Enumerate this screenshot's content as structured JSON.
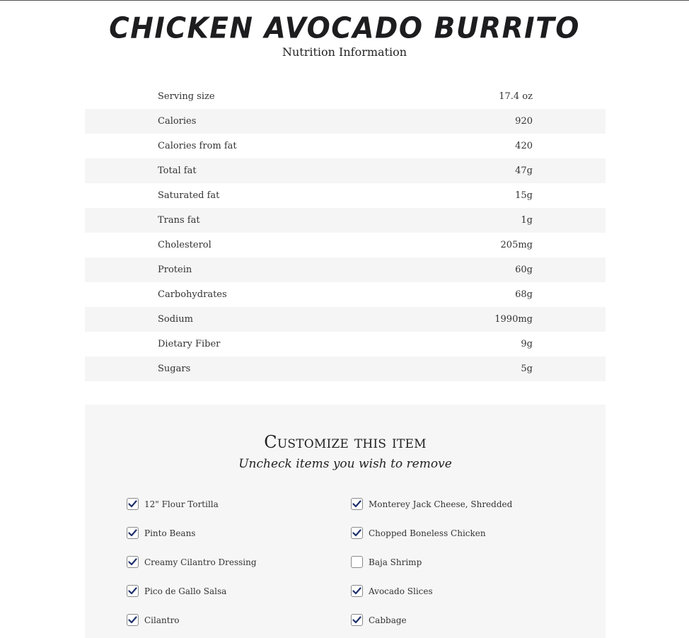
{
  "header": {
    "title": "CHICKEN AVOCADO BURRITO",
    "subtitle": "Nutrition Information"
  },
  "nutrition": [
    {
      "label": "Serving size",
      "value": "17.4 oz"
    },
    {
      "label": "Calories",
      "value": "920"
    },
    {
      "label": "Calories from fat",
      "value": "420"
    },
    {
      "label": "Total fat",
      "value": "47g"
    },
    {
      "label": "Saturated fat",
      "value": "15g"
    },
    {
      "label": "Trans fat",
      "value": "1g"
    },
    {
      "label": "Cholesterol",
      "value": "205mg"
    },
    {
      "label": "Protein",
      "value": "60g"
    },
    {
      "label": "Carbohydrates",
      "value": "68g"
    },
    {
      "label": "Sodium",
      "value": "1990mg"
    },
    {
      "label": "Dietary Fiber",
      "value": "9g"
    },
    {
      "label": "Sugars",
      "value": "5g"
    }
  ],
  "customize": {
    "title": "Customize this item",
    "subtitle": "Uncheck items you wish to remove",
    "left_options": [
      {
        "label": "12\" Flour Tortilla",
        "checked": true
      },
      {
        "label": "Pinto Beans",
        "checked": true
      },
      {
        "label": "Creamy Cilantro Dressing",
        "checked": true
      },
      {
        "label": "Pico de Gallo Salsa",
        "checked": true
      },
      {
        "label": "Cilantro",
        "checked": true
      }
    ],
    "right_options": [
      {
        "label": "Monterey Jack Cheese, Shredded",
        "checked": true
      },
      {
        "label": "Chopped Boneless Chicken",
        "checked": true
      },
      {
        "label": "Baja Shrimp",
        "checked": false
      },
      {
        "label": "Avocado Slices",
        "checked": true
      },
      {
        "label": "Cabbage",
        "checked": true
      }
    ]
  },
  "colors": {
    "check_mark": "#1e2f6b",
    "stripe": "#f5f5f5",
    "panel": "#f6f6f6"
  }
}
